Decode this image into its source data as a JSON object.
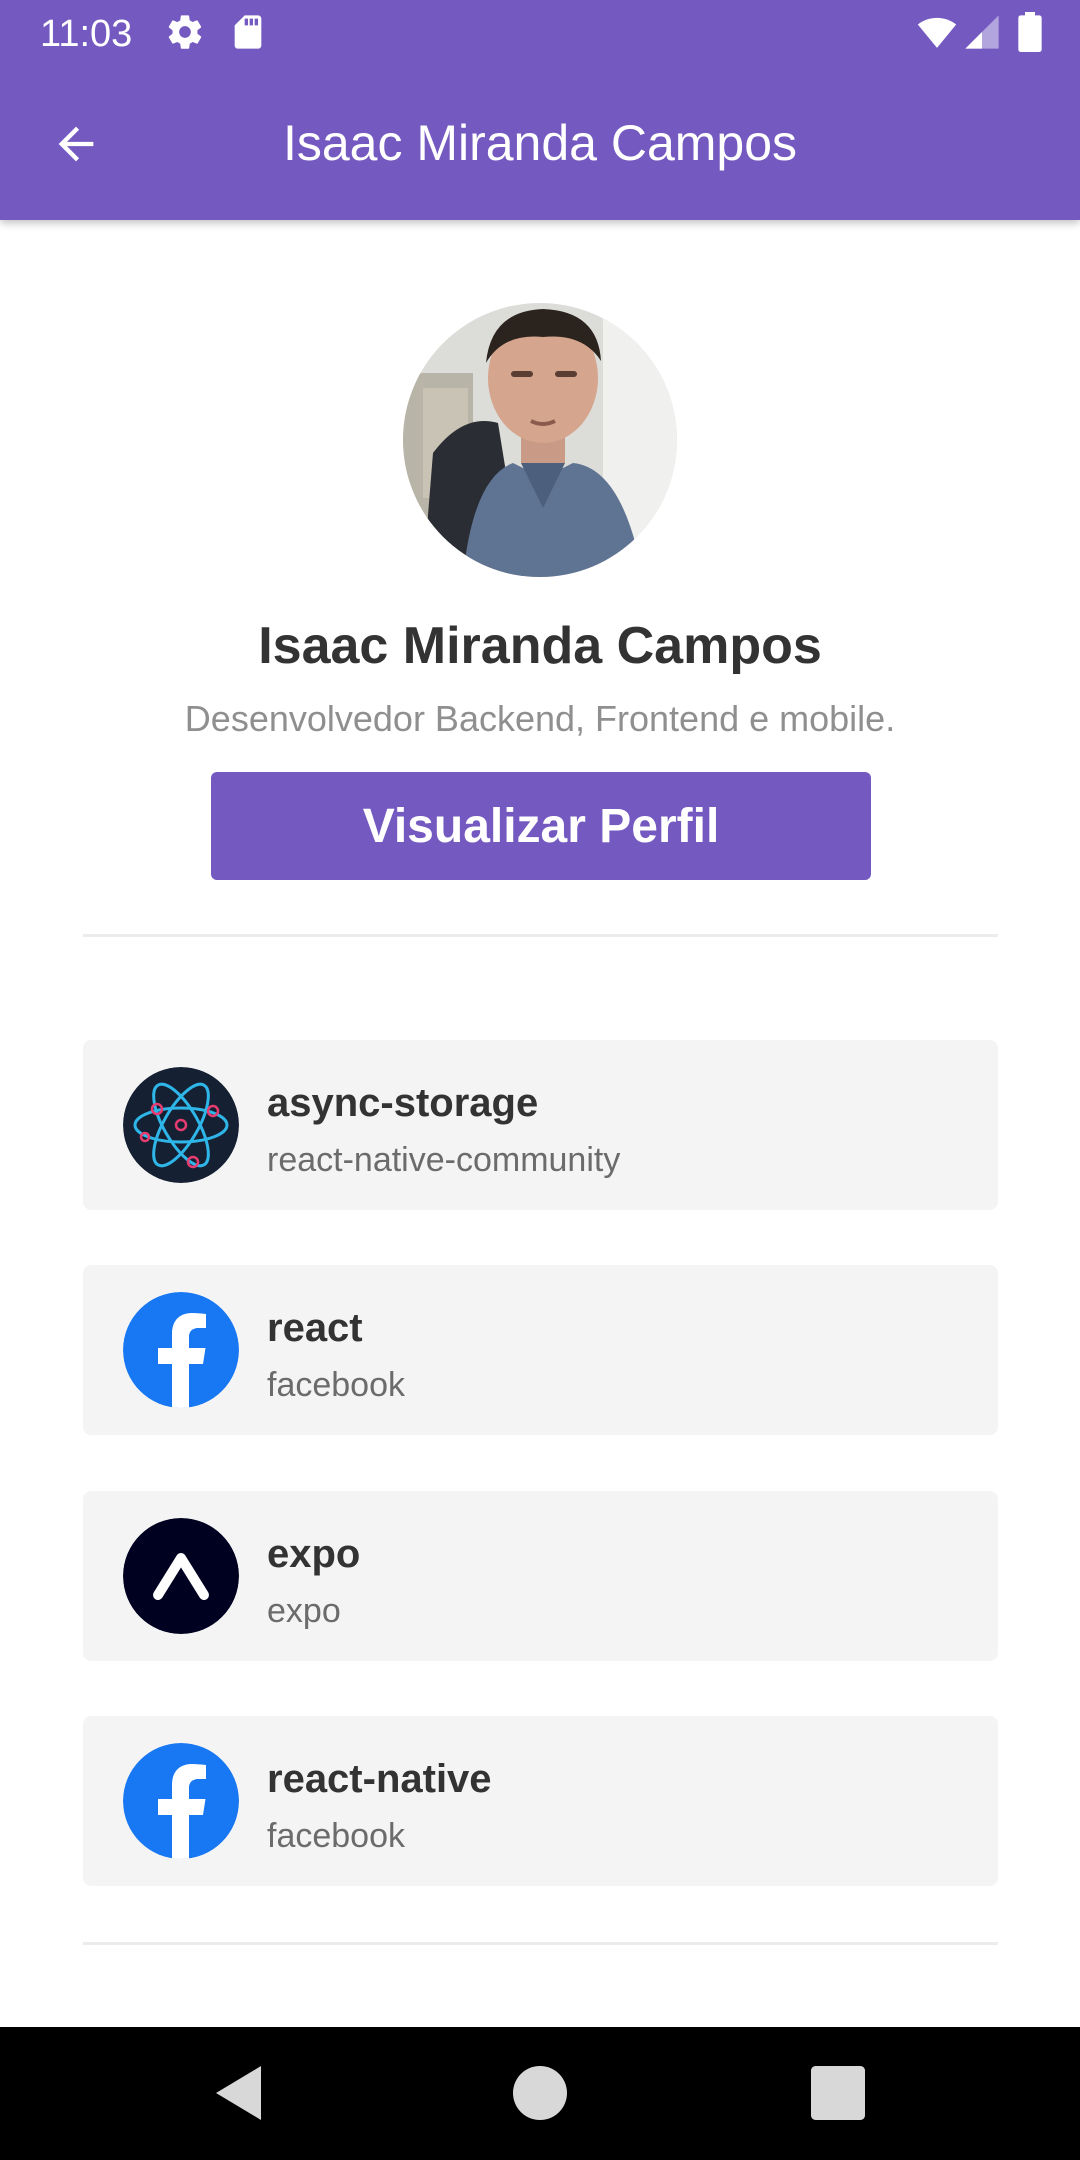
{
  "status_bar": {
    "time": "11:03",
    "left_icons": [
      "settings-icon",
      "sd-card-icon"
    ],
    "right_icons": [
      "wifi-icon",
      "signal-icon",
      "battery-icon"
    ]
  },
  "app_bar": {
    "back_icon": "arrow-back-icon",
    "title": "Isaac Miranda Campos"
  },
  "profile": {
    "name": "Isaac Miranda Campos",
    "bio": "Desenvolvedor Backend, Frontend e mobile.",
    "button_label": "Visualizar Perfil"
  },
  "repositories": [
    {
      "name": "async-storage",
      "owner": "react-native-community",
      "logo": "react-atom-logo"
    },
    {
      "name": "react",
      "owner": "facebook",
      "logo": "facebook-logo"
    },
    {
      "name": "expo",
      "owner": "expo",
      "logo": "expo-logo"
    },
    {
      "name": "react-native",
      "owner": "facebook",
      "logo": "facebook-logo"
    }
  ],
  "nav_bar": {
    "buttons": [
      "back-triangle-icon",
      "home-circle-icon",
      "recents-square-icon"
    ]
  },
  "colors": {
    "primary": "#7459c1",
    "card_background": "#f4f4f4",
    "facebook_blue": "#1877f2",
    "expo_dark": "#000020"
  }
}
